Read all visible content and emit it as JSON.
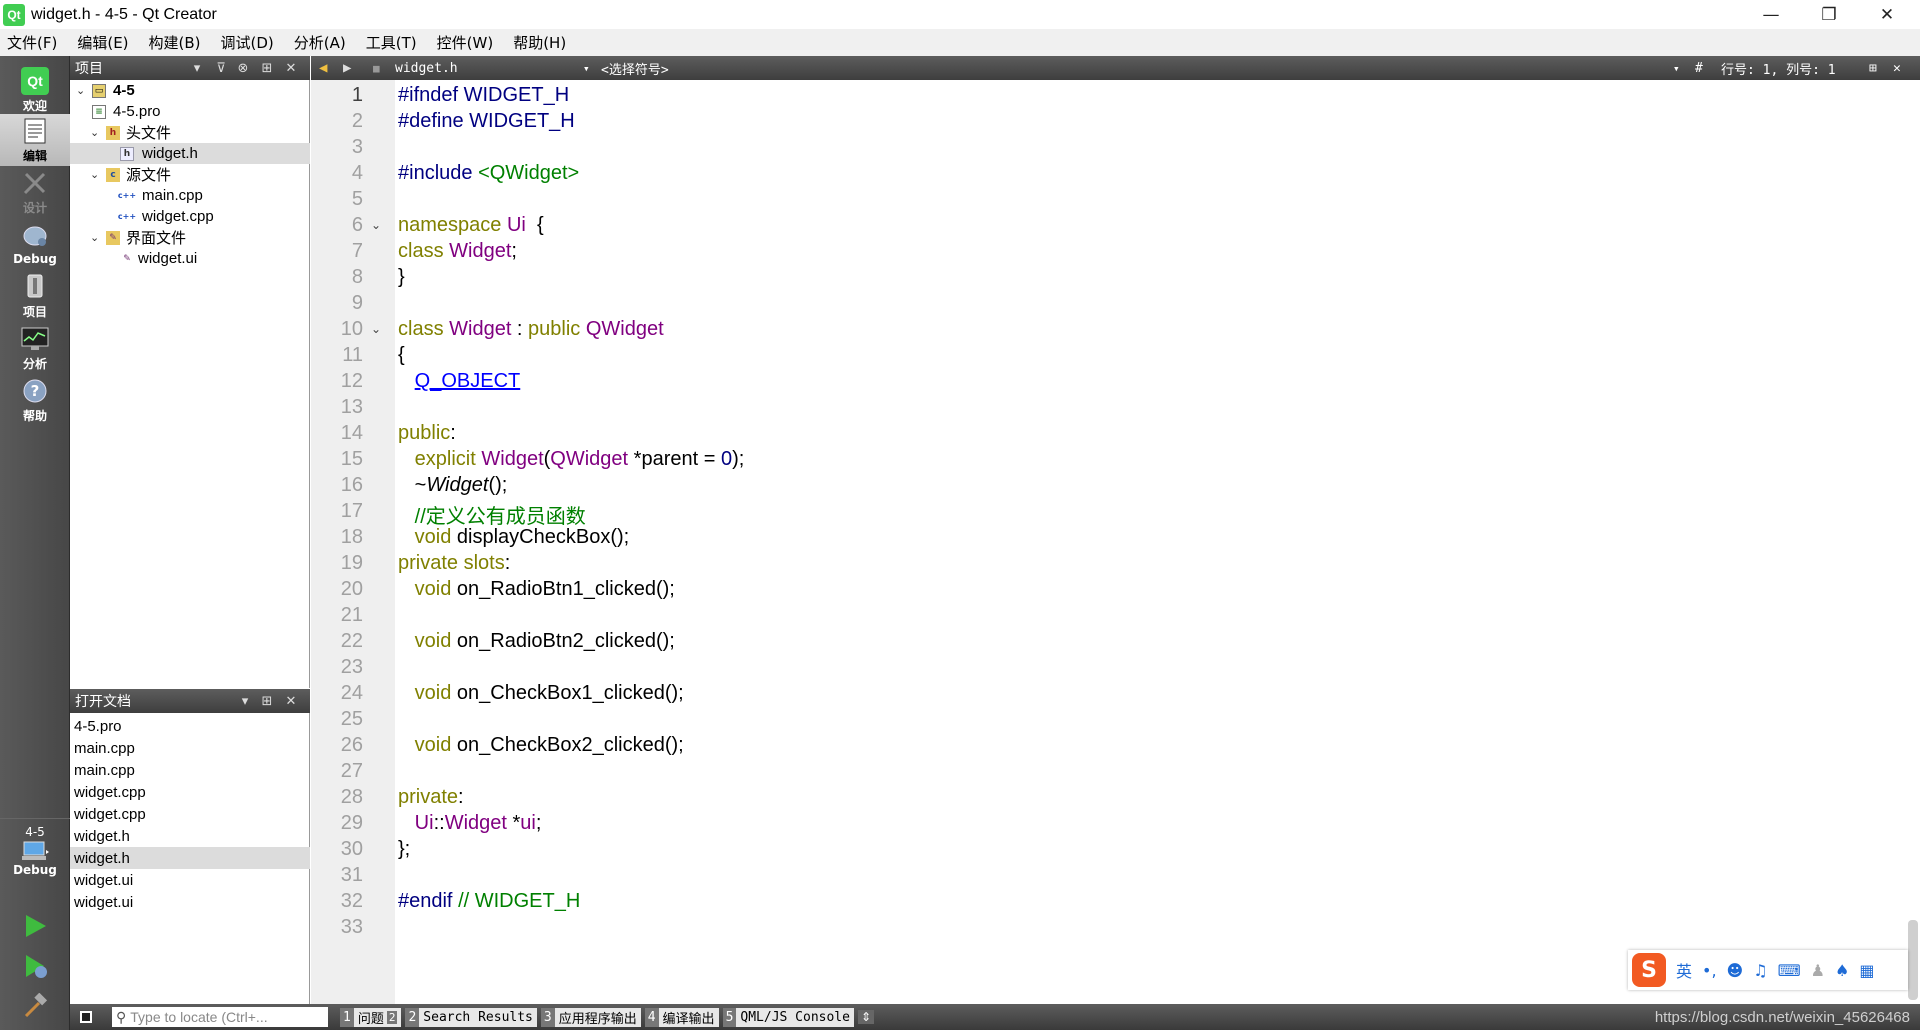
{
  "window": {
    "title": "widget.h - 4-5 - Qt Creator",
    "logo_text": "Qt",
    "controls": {
      "minimize": "—",
      "restore": "❐",
      "close": "✕"
    }
  },
  "menu": [
    "文件(F)",
    "编辑(E)",
    "构建(B)",
    "调试(D)",
    "分析(A)",
    "工具(T)",
    "控件(W)",
    "帮助(H)"
  ],
  "modes": [
    {
      "label": "欢迎",
      "icon": "qt-logo-icon"
    },
    {
      "label": "编辑",
      "icon": "edit-document-icon"
    },
    {
      "label": "设计",
      "icon": "design-pen-icon"
    },
    {
      "label": "Debug",
      "icon": "debug-bug-icon"
    },
    {
      "label": "项目",
      "icon": "project-wrench-icon"
    },
    {
      "label": "分析",
      "icon": "analyze-monitor-icon"
    },
    {
      "label": "帮助",
      "icon": "help-question-icon"
    }
  ],
  "target": {
    "project": "4-5",
    "config": "Debug"
  },
  "project_pane": {
    "title": "项目",
    "tree": [
      {
        "label": "4-5",
        "level": 0,
        "arrow": "v",
        "icon": "P"
      },
      {
        "label": "4-5.pro",
        "level": 1,
        "arrow": "",
        "icon": "pro"
      },
      {
        "label": "头文件",
        "level": 1,
        "arrow": "v",
        "icon": "h"
      },
      {
        "label": "widget.h",
        "level": 2,
        "arrow": "",
        "icon": "h"
      },
      {
        "label": "源文件",
        "level": 1,
        "arrow": "v",
        "icon": "c"
      },
      {
        "label": "main.cpp",
        "level": 2,
        "arrow": "",
        "icon": "c++"
      },
      {
        "label": "widget.cpp",
        "level": 2,
        "arrow": "",
        "icon": "c++"
      },
      {
        "label": "界面文件",
        "level": 1,
        "arrow": "v",
        "icon": "ui"
      },
      {
        "label": "widget.ui",
        "level": 2,
        "arrow": "",
        "icon": "ui"
      }
    ]
  },
  "open_docs": {
    "title": "打开文档",
    "items": [
      "4-5.pro",
      "main.cpp",
      "main.cpp",
      "widget.cpp",
      "widget.cpp",
      "widget.h",
      "widget.h",
      "widget.ui",
      "widget.ui"
    ]
  },
  "editor_toolbar": {
    "file": "widget.h",
    "symbol": "<选择符号>",
    "position": "行号: 1, 列号: 1"
  },
  "code": {
    "current_line": 1,
    "folds": [
      6,
      10
    ],
    "lines": [
      [
        [
          "pp",
          "#ifndef "
        ],
        [
          "nm",
          "WIDGET_H"
        ]
      ],
      [
        [
          "pp",
          "#define "
        ],
        [
          "nm",
          "WIDGET_H"
        ]
      ],
      [],
      [
        [
          "pp",
          "#include "
        ],
        [
          "str",
          "<QWidget>"
        ]
      ],
      [],
      [
        [
          "kw",
          "namespace "
        ],
        [
          "ty",
          "Ui"
        ],
        [
          "",
          "  {"
        ]
      ],
      [
        [
          "kw",
          "class "
        ],
        [
          "ty",
          "Widget"
        ],
        [
          "",
          ";"
        ]
      ],
      [
        [
          "",
          "}"
        ]
      ],
      [],
      [
        [
          "kw",
          "class "
        ],
        [
          "ty",
          "Widget"
        ],
        [
          "",
          " : "
        ],
        [
          "kw",
          "public "
        ],
        [
          "ty",
          "QWidget"
        ]
      ],
      [
        [
          "",
          "{"
        ]
      ],
      [
        [
          "",
          "   "
        ],
        [
          "lk",
          "Q_OBJECT"
        ]
      ],
      [],
      [
        [
          "kw",
          "public"
        ],
        [
          "",
          ":"
        ]
      ],
      [
        [
          "",
          "   "
        ],
        [
          "kw",
          "explicit "
        ],
        [
          "ty",
          "Widget"
        ],
        [
          "",
          "("
        ],
        [
          "ty",
          "QWidget"
        ],
        [
          "",
          " *parent = "
        ],
        [
          "nm",
          "0"
        ],
        [
          "",
          ");"
        ]
      ],
      [
        [
          "",
          "   ~"
        ],
        [
          "it",
          "Widget"
        ],
        [
          "",
          "();"
        ]
      ],
      [
        [
          "",
          "   "
        ],
        [
          "cm",
          "//定义公有成员函数"
        ]
      ],
      [
        [
          "",
          "   "
        ],
        [
          "kw",
          "void "
        ],
        [
          "",
          "displayCheckBox();"
        ]
      ],
      [
        [
          "kw",
          "private slots"
        ],
        [
          "",
          ":"
        ]
      ],
      [
        [
          "",
          "   "
        ],
        [
          "kw",
          "void "
        ],
        [
          "",
          "on_RadioBtn1_clicked();"
        ]
      ],
      [],
      [
        [
          "",
          "   "
        ],
        [
          "kw",
          "void "
        ],
        [
          "",
          "on_RadioBtn2_clicked();"
        ]
      ],
      [],
      [
        [
          "",
          "   "
        ],
        [
          "kw",
          "void "
        ],
        [
          "",
          "on_CheckBox1_clicked();"
        ]
      ],
      [],
      [
        [
          "",
          "   "
        ],
        [
          "kw",
          "void "
        ],
        [
          "",
          "on_CheckBox2_clicked();"
        ]
      ],
      [],
      [
        [
          "kw",
          "private"
        ],
        [
          "",
          ":"
        ]
      ],
      [
        [
          "",
          "   "
        ],
        [
          "ty",
          "Ui"
        ],
        [
          "",
          "::"
        ],
        [
          "ty",
          "Widget"
        ],
        [
          "",
          " *"
        ],
        [
          "ty",
          "ui"
        ],
        [
          "",
          ";"
        ]
      ],
      [
        [
          "",
          "};"
        ]
      ],
      [],
      [
        [
          "pp",
          "#endif "
        ],
        [
          "cm",
          "// WIDGET_H"
        ]
      ],
      []
    ]
  },
  "status": {
    "locate_placeholder": "Type to locate (Ctrl+...",
    "outputs": [
      {
        "num": "1",
        "label": "问题",
        "badge": "2"
      },
      {
        "num": "2",
        "label": "Search Results"
      },
      {
        "num": "3",
        "label": "应用程序输出"
      },
      {
        "num": "4",
        "label": "编译输出"
      },
      {
        "num": "5",
        "label": "QML/JS Console"
      }
    ],
    "watermark": "https://blog.csdn.net/weixin_45626468"
  },
  "ime": {
    "logo": "S",
    "mode": "英",
    "symbols": "•,"
  },
  "colors": {
    "keyword": "#808000",
    "preprocessor": "#000080",
    "string": "#008000",
    "type": "#800080",
    "comment": "#008000",
    "link": "#0000ff"
  }
}
